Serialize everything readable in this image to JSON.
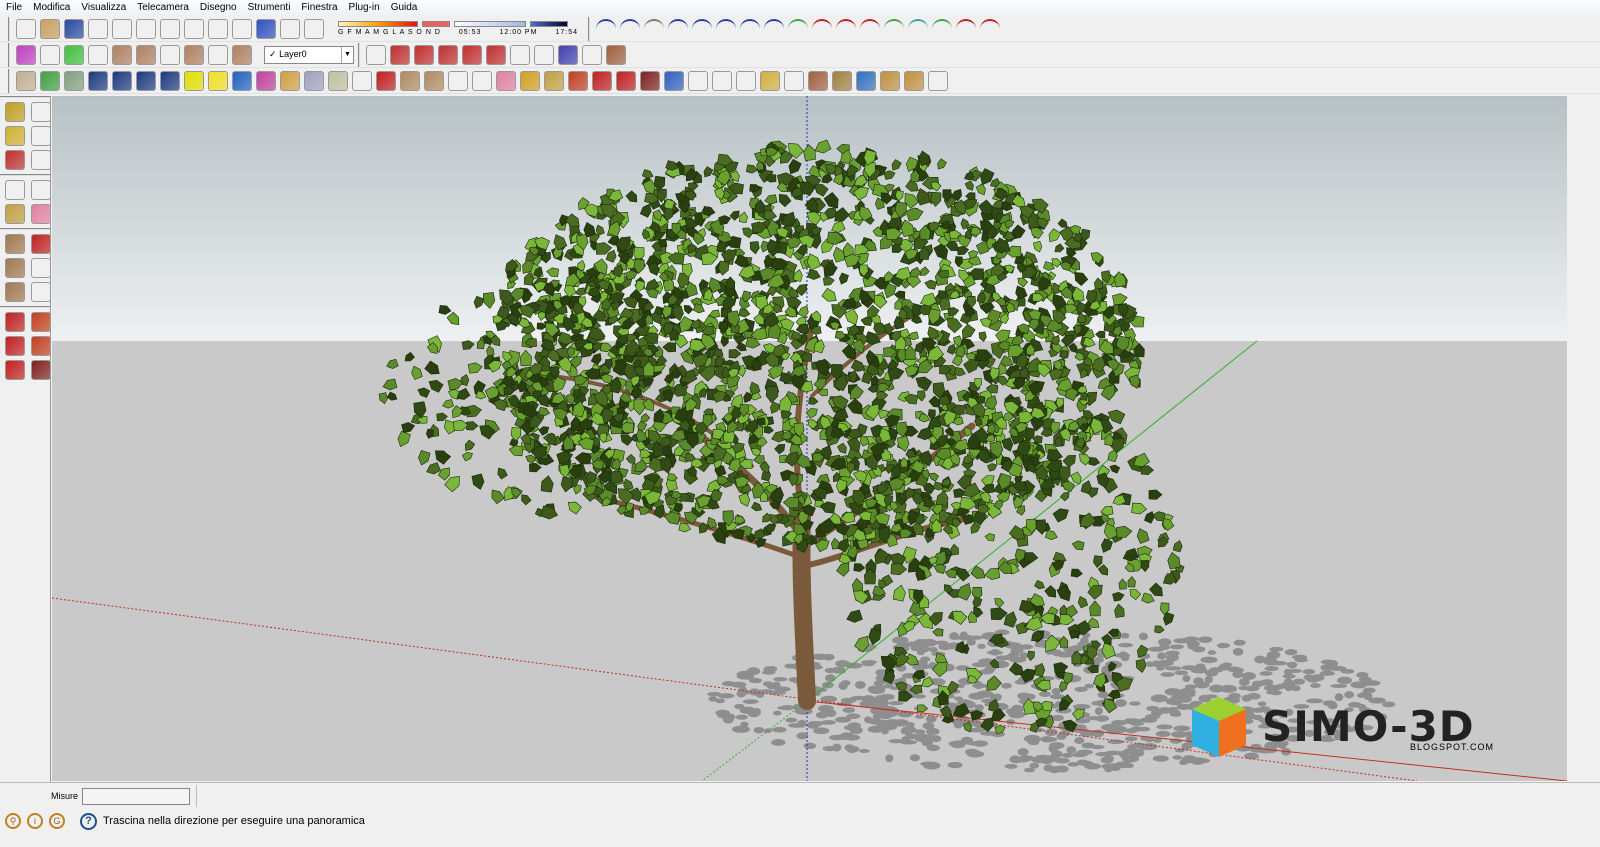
{
  "menu": [
    "File",
    "Modifica",
    "Visualizza",
    "Telecamera",
    "Disegno",
    "Strumenti",
    "Finestra",
    "Plug-in",
    "Guida"
  ],
  "shadow": {
    "months": "G F M A M G L A S O N D",
    "time_start": "05:53",
    "time_mid": "12:00 PM",
    "time_end": "17:54"
  },
  "layer": {
    "check": "✓",
    "name": "Layer0"
  },
  "measure": {
    "label": "Misure",
    "value": ""
  },
  "status": {
    "help": "?",
    "text": "Trascina nella direzione per eseguire una panoramica"
  },
  "watermark": {
    "title": "SIMO-3D",
    "subtitle": "BLOGSPOT.COM"
  },
  "colors": {
    "sky_top": "#b7c1c4",
    "sky_bottom": "#eef0f1",
    "ground": "#c9c9c9",
    "leaf": "#3d5a1c",
    "trunk": "#7a5a3a"
  },
  "toolbar1a": [
    [
      "new-icon",
      "#fff"
    ],
    [
      "open-icon",
      "#c9a060"
    ],
    [
      "save-icon",
      "#2a4aa0"
    ],
    [
      "cut-icon",
      "#ccc"
    ],
    [
      "copy-icon",
      "#ddd"
    ],
    [
      "paste-icon",
      "#ddd"
    ],
    [
      "delete-icon",
      "#999"
    ],
    [
      "undo-icon",
      "#333"
    ],
    [
      "redo-icon",
      "#aaa"
    ],
    [
      "print-icon",
      "#666"
    ],
    [
      "model-info-icon",
      "#3050c0"
    ],
    [
      "shadow-settings-icon",
      "#222"
    ],
    [
      "shadow-toggle-icon",
      "#222"
    ]
  ],
  "toolbar1b": [
    [
      "arc-icon",
      "#2040a0"
    ],
    [
      "freehand-icon",
      "#2040a0"
    ],
    [
      "spline-icon",
      "#777"
    ],
    [
      "curve-icon",
      "#2040a0"
    ],
    [
      "curve2-icon",
      "#2040a0"
    ],
    [
      "arc2-icon",
      "#2040a0"
    ],
    [
      "spiral-icon",
      "#2040a0"
    ],
    [
      "arc3-icon",
      "#2040a0"
    ],
    [
      "bezier-icon",
      "#40a040"
    ],
    [
      "arc4-icon",
      "#c02020"
    ],
    [
      "arc5-icon",
      "#c02020"
    ],
    [
      "arc6-icon",
      "#c02020"
    ],
    [
      "curve3-icon",
      "#40a040"
    ],
    [
      "circle-icon",
      "#40a0a0"
    ],
    [
      "wrench-icon",
      "#40a040"
    ],
    [
      "ellipse-icon",
      "#c02020"
    ],
    [
      "polygon-icon",
      "#c02020"
    ]
  ],
  "toolbar2": [
    [
      "color-picker-icon",
      "#c040c0"
    ],
    [
      "select-icon",
      "#444"
    ],
    [
      "color-picker2-icon",
      "#40c040"
    ],
    [
      "select2-icon",
      "#444"
    ],
    [
      "iso-view-icon",
      "#b08060"
    ],
    [
      "front-view-icon",
      "#b08060"
    ],
    [
      "top-view-icon",
      "#fff"
    ],
    [
      "right-view-icon",
      "#b08060"
    ],
    [
      "back-view-icon",
      "#fff"
    ],
    [
      "left-view-icon",
      "#b08060"
    ]
  ],
  "toolbar2b": [
    [
      "layer-manager-icon",
      "#aaa"
    ],
    [
      "axis-j-icon",
      "#c03030"
    ],
    [
      "axis-v-icon",
      "#c03030"
    ],
    [
      "axis-n-icon",
      "#c03030"
    ],
    [
      "rotate-left-icon",
      "#c03030"
    ],
    [
      "rotate-right-icon",
      "#c03030"
    ],
    [
      "xray-icon",
      "#999"
    ],
    [
      "wireframe-icon",
      "#666"
    ],
    [
      "hidden-line-icon",
      "#4040b0"
    ],
    [
      "edges-icon",
      "#777"
    ],
    [
      "joystick-icon",
      "#a06040"
    ]
  ],
  "toolbar3": [
    [
      "sandbox-icon",
      "#c0b090"
    ],
    [
      "follow-me-icon",
      "#40a040"
    ],
    [
      "mesh-icon",
      "#80a080"
    ],
    [
      "scene1-icon",
      "#1a3a80"
    ],
    [
      "scene2-icon",
      "#1a3a80"
    ],
    [
      "film-icon",
      "#1a3a80"
    ],
    [
      "tree-icon",
      "#1a3a80"
    ],
    [
      "light-icon",
      "#e0e000"
    ],
    [
      "cone-icon",
      "#f0e020"
    ],
    [
      "palette-icon",
      "#2060c0"
    ],
    [
      "dots-icon",
      "#c040a0"
    ],
    [
      "solid1-icon",
      "#d0a040"
    ],
    [
      "solid2-icon",
      "#a0a0c0"
    ],
    [
      "solid3-icon",
      "#c0c0a0"
    ],
    [
      "pointer-icon",
      "#888"
    ],
    [
      "pencil-icon",
      "#c02020"
    ],
    [
      "rectangle-icon",
      "#b08a60"
    ],
    [
      "circle-tool-icon",
      "#b08a60"
    ],
    [
      "arc-tool-icon",
      "#444"
    ],
    [
      "eraser-icon",
      "#ddd"
    ],
    [
      "eraser2-icon",
      "#e080a0"
    ],
    [
      "tape-icon",
      "#d0a020"
    ],
    [
      "paint-icon",
      "#c0a040"
    ],
    [
      "pushpull-icon",
      "#c04020"
    ],
    [
      "move-icon",
      "#c02020"
    ],
    [
      "rotate-icon",
      "#c02020"
    ],
    [
      "followme-icon",
      "#802020"
    ],
    [
      "orbit-icon",
      "#3060c0"
    ],
    [
      "pan-icon",
      "#ddd"
    ],
    [
      "zoom-icon",
      "#666"
    ],
    [
      "zoom-extents-icon",
      "#666"
    ],
    [
      "warehouse-icon",
      "#d0b040"
    ],
    [
      "components-icon",
      "#aaa"
    ],
    [
      "share-icon",
      "#a06040"
    ],
    [
      "extension-icon",
      "#a08040"
    ],
    [
      "earth-icon",
      "#3070c0"
    ],
    [
      "get-models-icon",
      "#c09040"
    ],
    [
      "export-icon",
      "#c09040"
    ],
    [
      "print2-icon",
      "#ccc"
    ]
  ],
  "lefttools": [
    [
      [
        "tape-measure-icon",
        "#c0a020"
      ],
      [
        "dimension-icon",
        "#444"
      ]
    ],
    [
      [
        "protractor-icon",
        "#d0b030"
      ],
      [
        "text-icon",
        "#888"
      ]
    ],
    [
      [
        "axes-icon",
        "#c03030"
      ],
      [
        "3d-text-icon",
        "#555"
      ]
    ],
    [
      [
        "select-tool-icon",
        "#999"
      ],
      [
        "component-tool-icon",
        "#ccc"
      ]
    ],
    [
      [
        "paint-bucket-icon",
        "#c0a040"
      ],
      [
        "eraser-tool-icon",
        "#e080a0"
      ]
    ],
    [
      [
        "rectangle-draw-icon",
        "#a07850"
      ],
      [
        "line-icon",
        "#c02020"
      ]
    ],
    [
      [
        "circle-draw-icon",
        "#a07850"
      ],
      [
        "arc-draw-icon",
        "#444"
      ]
    ],
    [
      [
        "polygon-draw-icon",
        "#a07850"
      ],
      [
        "freehand-draw-icon",
        "#444"
      ]
    ],
    [
      [
        "move-tool-icon",
        "#c02020"
      ],
      [
        "pushpull-tool-icon",
        "#c04020"
      ]
    ],
    [
      [
        "rotate-tool-icon",
        "#c02020"
      ],
      [
        "followme-tool-icon",
        "#c04020"
      ]
    ],
    [
      [
        "scale-tool-icon",
        "#c02020"
      ],
      [
        "offset-tool-icon",
        "#802020"
      ]
    ]
  ]
}
